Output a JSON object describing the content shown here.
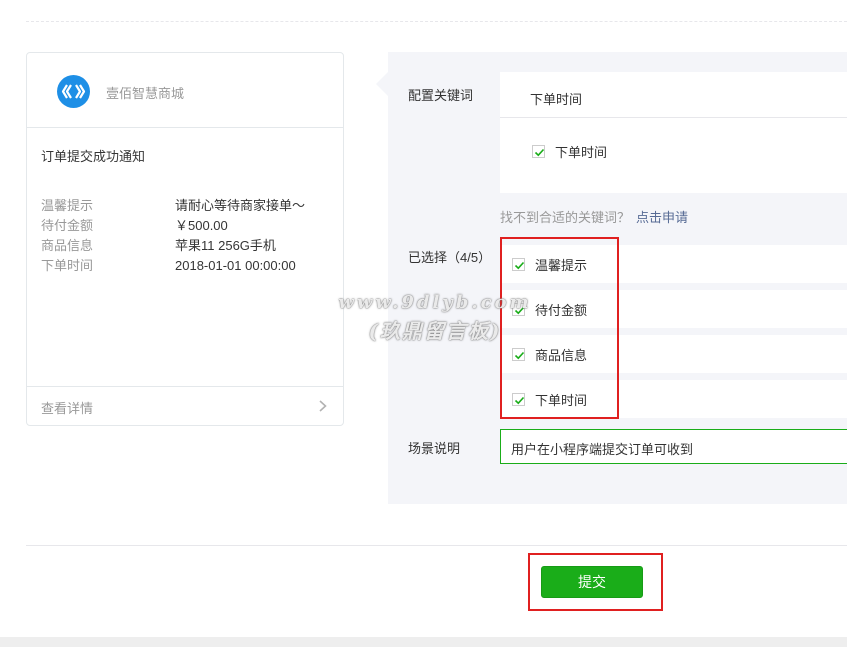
{
  "preview": {
    "store_name": "壹佰智慧商城",
    "notice_title": "订单提交成功通知",
    "rows": [
      {
        "key": "温馨提示",
        "value": "请耐心等待商家接单～"
      },
      {
        "key": "待付金额",
        "value": "￥500.00"
      },
      {
        "key": "商品信息",
        "value": "苹果11 256G手机"
      },
      {
        "key": "下单时间",
        "value": "2018-01-01 00:00:00"
      }
    ],
    "details_label": "查看详情"
  },
  "config": {
    "keywords_label": "配置关键词",
    "keyword_search_value": "下单时间",
    "keyword_option": {
      "label": "下单时间",
      "checked": true
    },
    "hint_text": "找不到合适的关键词？",
    "hint_link": "点击申请",
    "selected_label": "已选择（4/5）",
    "selected_items": [
      {
        "label": "温馨提示",
        "checked": true
      },
      {
        "label": "待付金额",
        "checked": true
      },
      {
        "label": "商品信息",
        "checked": true
      },
      {
        "label": "下单时间",
        "checked": true
      }
    ],
    "scene_label": "场景说明",
    "scene_value": "用户在小程序端提交订单可收到"
  },
  "submit_label": "提交",
  "watermark": {
    "line1": "www.9dlyb.com",
    "line2": "(玖鼎留言板)"
  },
  "colors": {
    "accent": "#1aad19",
    "link": "#576b95",
    "highlight": "#e02020",
    "panel_bg": "#f4f5f9"
  }
}
